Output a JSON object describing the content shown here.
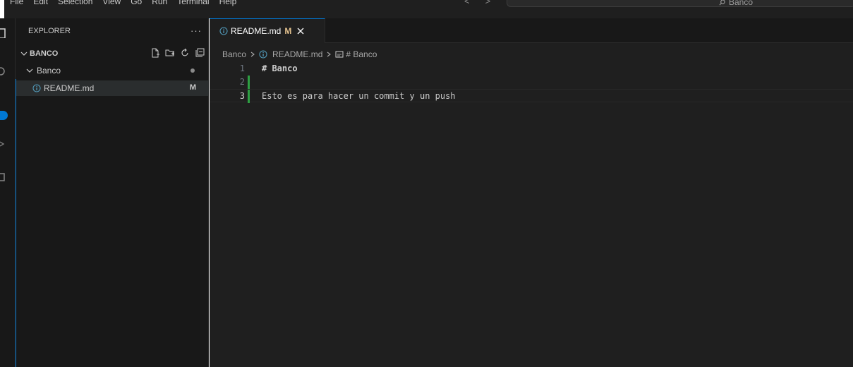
{
  "menu": [
    "File",
    "Edit",
    "Selection",
    "View",
    "Go",
    "Run",
    "Terminal",
    "Help"
  ],
  "search": {
    "text": "Banco"
  },
  "sidebar": {
    "title": "EXPLORER",
    "more": "···",
    "section": "BANCO",
    "folder": "Banco",
    "file": {
      "name": "README.md",
      "status": "M"
    }
  },
  "tab": {
    "name": "README.md",
    "status": "M"
  },
  "breadcrumb": {
    "folder": "Banco",
    "file": "README.md",
    "symbol": "# Banco"
  },
  "editor": {
    "lines": [
      {
        "number": "1",
        "text": "# Banco"
      },
      {
        "number": "2",
        "text": ""
      },
      {
        "number": "3",
        "text": "Esto es para hacer un commit y un push"
      }
    ]
  },
  "colors": {
    "accent": "#0078d4",
    "added": "#2ea043",
    "heading": "#569cd6",
    "modified": "#e2c08d"
  }
}
